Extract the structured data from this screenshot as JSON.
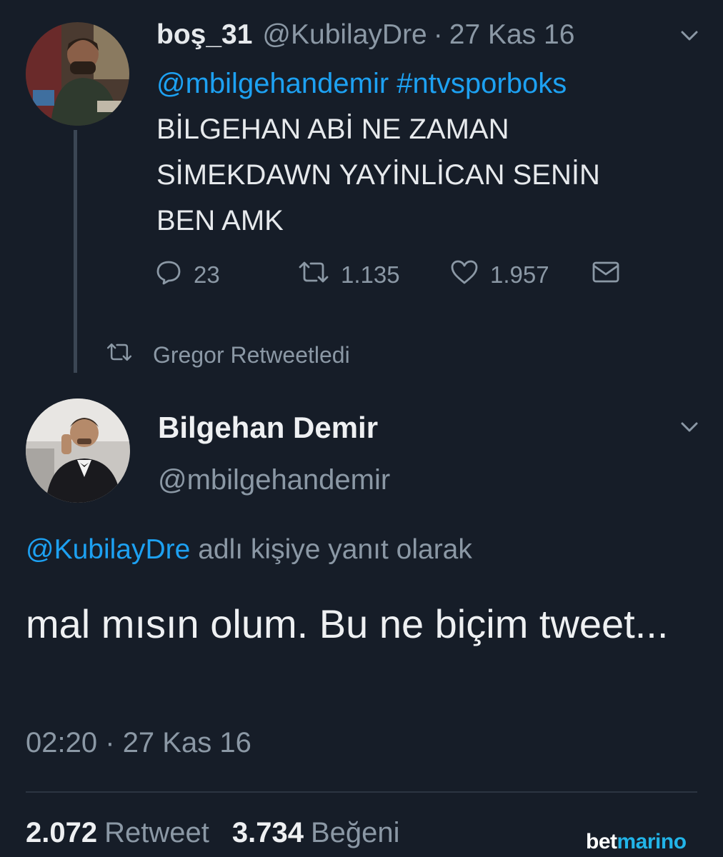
{
  "tweet1": {
    "author_name": "boş_31",
    "handle": "@KubilayDre",
    "date": "27 Kas 16",
    "mention_line": "@mbilgehandemir #ntvsporboks",
    "text_lines": [
      "BİLGEHAN ABİ NE ZAMAN",
      "SİMEKDAWN YAYİNLİCAN SENİN",
      "BEN AMK"
    ],
    "reply_count": "23",
    "retweet_count": "1.135",
    "like_count": "1.957"
  },
  "retweet_notice": "Gregor Retweetledi",
  "tweet2": {
    "author_name": "Bilgehan Demir",
    "handle": "@mbilgehandemir",
    "reply_to_handle": "@KubilayDre",
    "reply_to_suffix": "adlı kişiye yanıt olarak",
    "text": "mal mısın olum. Bu ne biçim tweet...",
    "time": "02:20",
    "date": "27 Kas 16",
    "retweet_count": "2.072",
    "retweet_label": "Retweet",
    "like_count": "3.734",
    "like_label": "Beğeni"
  },
  "watermark": {
    "part1": "bet",
    "part2": "marino"
  },
  "separator": "·",
  "colors": {
    "background": "#161d28",
    "link": "#1da1f2",
    "muted": "#8b98a5",
    "text": "#e6e9ec",
    "brand_accent": "#22b4e8"
  },
  "icons": [
    "reply-icon",
    "retweet-icon",
    "like-icon",
    "dm-icon",
    "chevron-down-icon"
  ]
}
